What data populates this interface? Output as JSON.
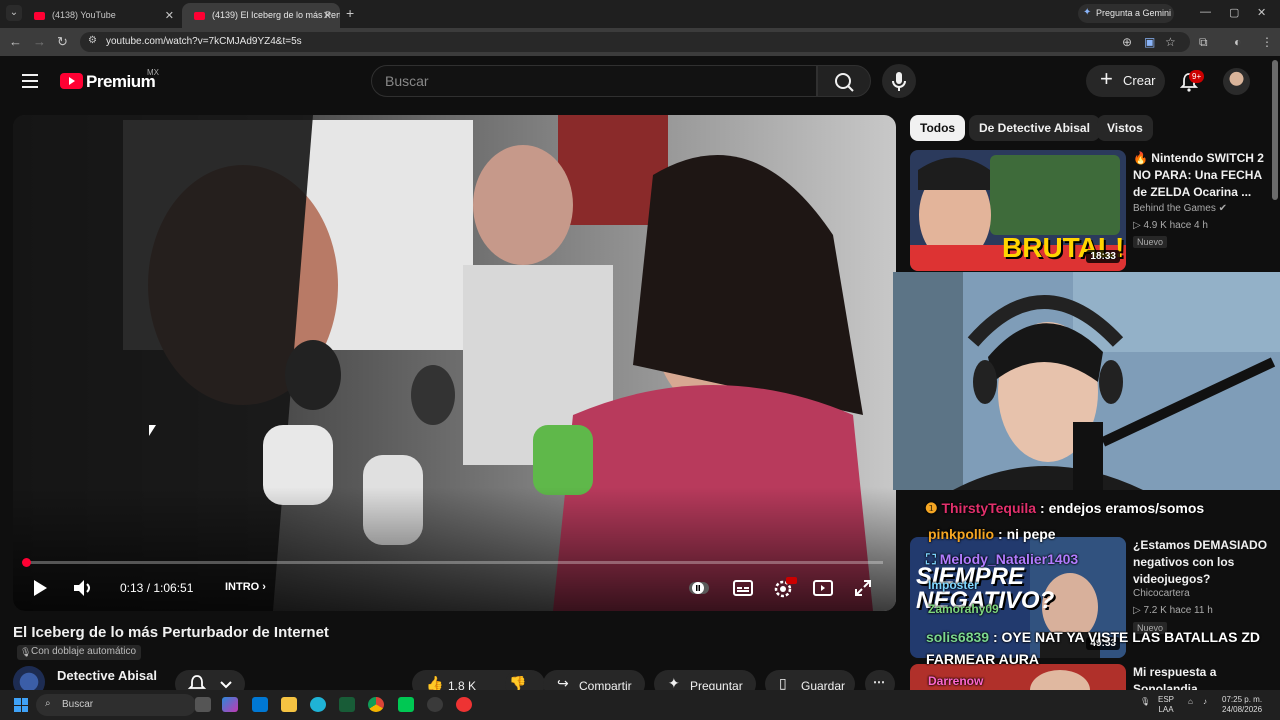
{
  "browser": {
    "tabs": [
      {
        "label": "(4138) YouTube"
      },
      {
        "label": "(4139) El Iceberg de lo más Pertur"
      }
    ],
    "new_tab_glyph": "+",
    "gemini_label": "Pregunta a Gemini",
    "url": "youtube.com/watch?v=7kCMJAd9YZ4&t=5s",
    "window_controls": [
      "—",
      "▢",
      "✕"
    ]
  },
  "header": {
    "logo_text": "Premium",
    "country": "MX",
    "search_placeholder": "Buscar",
    "create_label": "Crear",
    "notif_count": "9+"
  },
  "player": {
    "current_time": "0:13",
    "duration": "1:06:51",
    "time_display": "0:13 / 1:06:51",
    "chapter": "INTRO",
    "progress_fraction": 0.0032
  },
  "video": {
    "title": "El Iceberg de lo más Perturbador de Internet",
    "dub_label": "Con doblaje automático",
    "channel": "Detective Abisal",
    "likes": "1.8 K",
    "share_label": "Compartir",
    "ask_label": "Preguntar",
    "save_label": "Guardar"
  },
  "sidebar": {
    "chips": [
      "Todos",
      "De Detective Abisal",
      "Vistos"
    ],
    "videos": [
      {
        "title_lines": [
          "🔥 Nintendo SWITCH 2",
          "NO PARA: Una FECHA",
          "de ZELDA Ocarina ..."
        ],
        "channel": "Behind the Games",
        "stats": "▷ 4.9 K  hace 4 h",
        "badge": "Nuevo",
        "duration": "18:33",
        "thumb_text": "BRUTAL!"
      },
      {
        "title_lines": [
          "¿Estamos DEMASIADO",
          "negativos con los",
          "videojuegos?"
        ],
        "channel": "Chicocartera",
        "stats": "▷ 7.2 K  hace 11 h",
        "badge": "Nuevo",
        "duration": "49:53",
        "thumb_text": "SIEMPRE NEGATIVO?"
      },
      {
        "title_lines": [
          "Mi respuesta a",
          "Sonolandia"
        ],
        "channel": "",
        "stats": "",
        "badge": "",
        "duration": "",
        "thumb_text": ""
      }
    ]
  },
  "chat": [
    {
      "user": "ThirstyTequila",
      "message": "endejos eramos/somos",
      "user_color": "#e1306c"
    },
    {
      "user": "pinkpollio",
      "message": "ni pepe",
      "user_color": "#f5a623"
    },
    {
      "user": "Melody_Natalier1403",
      "message": "",
      "user_color": "#b17cff"
    },
    {
      "user": "Imposter",
      "message": "",
      "user_color": "#7ed6ff"
    },
    {
      "user": "Zamorahy09",
      "message": "",
      "user_color": "#7ed67e"
    },
    {
      "user": "solis6839",
      "message": "OYE NAT YA VISTE LAS BATALLAS ZD FARMEAR AURA",
      "user_color": "#7bd88f"
    },
    {
      "user": "Darrenow",
      "message": "",
      "user_color": "#ff66cc"
    },
    {
      "user": "Melody_Natalier1403",
      "message": "",
      "user_color": "#b17cff"
    }
  ],
  "taskbar": {
    "search_label": "Buscar",
    "lang_top": "ESP",
    "lang_bottom": "LAA",
    "time": "07:25 p. m.",
    "date": "24/08/2026"
  },
  "colors": {
    "accent": "#ff0033",
    "bg": "#0f0f0f",
    "chip": "#272727"
  }
}
